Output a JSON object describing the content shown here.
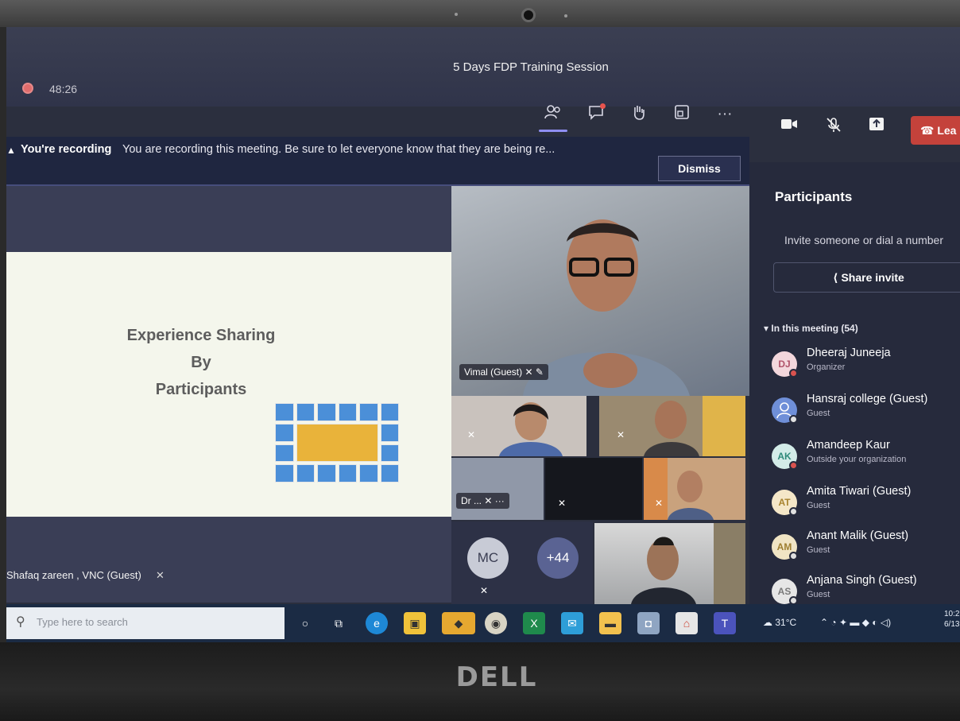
{
  "meeting": {
    "title": "5 Days FDP Training Session",
    "timer": "48:26"
  },
  "toolbar": {
    "people_icon": "people-icon",
    "chat_icon": "chat-icon",
    "reactions_icon": "raise-hand-icon",
    "rooms_icon": "breakout-rooms-icon",
    "more_label": "···",
    "leave_label": "Lea"
  },
  "banner": {
    "title": "You're recording",
    "text": "You are recording this meeting. Be sure to let everyone know that they are being re...",
    "dismiss_label": "Dismiss"
  },
  "slide": {
    "line1": "Experience Sharing",
    "line2": "By",
    "line3": "Participants",
    "presenter": "Shafaq zareen , VNC (Guest)"
  },
  "tiles": {
    "main_label": "Vimal (Guest)",
    "small_label": "Dr ...",
    "avatar_mc": "MC",
    "overflow": "+44"
  },
  "panel": {
    "title": "Participants",
    "invite_text": "Invite someone or dial a number",
    "share_label": "Share invite",
    "section_label": "In this meeting (54)",
    "participants": [
      {
        "initials": "DJ",
        "name": "Dheeraj Juneeja",
        "role": "Organizer",
        "avatar_color": "#f3d7dc",
        "initials_color": "#b0536a",
        "status": "#d9534f"
      },
      {
        "initials": "",
        "name": "Hansraj college (Guest)",
        "role": "Guest",
        "avatar_color": "#6f8fd8",
        "initials_color": "#ffffff",
        "status": "#e0e0e0"
      },
      {
        "initials": "AK",
        "name": "Amandeep Kaur",
        "role": "Outside your organization",
        "avatar_color": "#d3ece8",
        "initials_color": "#2f8a7a",
        "status": "#d9534f"
      },
      {
        "initials": "AT",
        "name": "Amita Tiwari (Guest)",
        "role": "Guest",
        "avatar_color": "#f5e7c8",
        "initials_color": "#a8832e",
        "status": "#e0e0e0"
      },
      {
        "initials": "AM",
        "name": "Anant Malik (Guest)",
        "role": "Guest",
        "avatar_color": "#f0e4c4",
        "initials_color": "#9d7d2f",
        "status": "#e0e0e0"
      },
      {
        "initials": "AS",
        "name": "Anjana Singh (Guest)",
        "role": "Guest",
        "avatar_color": "#e6e6e6",
        "initials_color": "#7a7a7a",
        "status": "#e0e0e0"
      }
    ]
  },
  "taskbar": {
    "search_placeholder": "Type here to search",
    "temperature": "31°C",
    "time": "10:2",
    "date": "6/13"
  },
  "device": {
    "brand": "DELL"
  }
}
